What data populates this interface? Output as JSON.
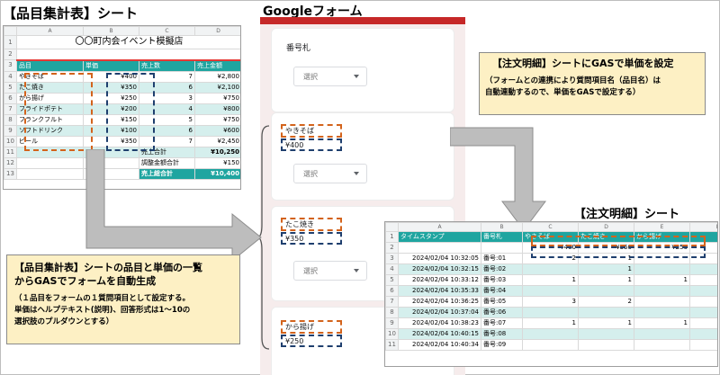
{
  "title_item_sheet": "【品目集計表】シート",
  "title_form": "Googleフォーム",
  "title_order_sheet": "【注文明細】シート",
  "sheet1": {
    "col_letters": [
      "A",
      "B",
      "C",
      "D"
    ],
    "row_numbers": [
      "1",
      "2",
      "3",
      "4",
      "5",
      "6",
      "7",
      "8",
      "9",
      "10",
      "11",
      "12",
      "13"
    ],
    "event_title": "〇〇町内会イベント模擬店",
    "headers": [
      "品目",
      "単価",
      "売上数",
      "売上金額"
    ],
    "items": [
      {
        "name": "やきそば",
        "price": "¥400",
        "qty": "7",
        "amount": "¥2,800"
      },
      {
        "name": "たこ焼き",
        "price": "¥350",
        "qty": "6",
        "amount": "¥2,100"
      },
      {
        "name": "から揚げ",
        "price": "¥250",
        "qty": "3",
        "amount": "¥750"
      },
      {
        "name": "フライドポテト",
        "price": "¥200",
        "qty": "4",
        "amount": "¥800"
      },
      {
        "name": "フランクフルト",
        "price": "¥150",
        "qty": "5",
        "amount": "¥750"
      },
      {
        "name": "ソフトドリンク",
        "price": "¥100",
        "qty": "6",
        "amount": "¥600"
      },
      {
        "name": "ビール",
        "price": "¥350",
        "qty": "7",
        "amount": "¥2,450"
      }
    ],
    "total_label": "売上合計",
    "total_value": "¥10,250",
    "adj_label": "調整金額合計",
    "adj_value": "¥150",
    "total2_label": "売上総合計",
    "total2_value": "¥10,400"
  },
  "form": {
    "q1_label": "番号札",
    "select_placeholder": "選択",
    "q2_label": "やきそば",
    "q2_price": "¥400",
    "q3_label": "たこ焼き",
    "q3_price": "¥350",
    "q4_label": "から揚げ",
    "q4_price": "¥250"
  },
  "note_top": {
    "line1": "【注文明細】シートにGASで単価を設定",
    "line2": "（フォームとの連携により質問項目名（品目名）は",
    "line3": "自動連動するので、単価をGASで設定する）"
  },
  "note_bottom": {
    "line1": "【品目集計表】シートの品目と単価の一覧",
    "line2": "からGASでフォームを自動生成",
    "line3": "（１品目をフォームの１質問項目として設定する。",
    "line4": "単価はヘルプテキスト(説明)、回答形式は1～10の",
    "line5": "選択肢のプルダウンとする）"
  },
  "sheet2": {
    "col_letters": [
      "A",
      "B",
      "C",
      "D",
      "E",
      "F"
    ],
    "headers": [
      "タイムスタンプ",
      "番号札",
      "やきそば",
      "たこ焼き",
      "から揚げ"
    ],
    "price_row": [
      "",
      "",
      "¥400",
      "¥350",
      "¥250"
    ],
    "rows": [
      {
        "rn": "3",
        "ts": "2024/02/04 10:32:05",
        "no": "番号:01",
        "a": "2",
        "b": "1",
        "c": ""
      },
      {
        "rn": "4",
        "ts": "2024/02/04 10:32:15",
        "no": "番号:02",
        "a": "",
        "b": "1",
        "c": ""
      },
      {
        "rn": "5",
        "ts": "2024/02/04 10:33:12",
        "no": "番号:03",
        "a": "1",
        "b": "1",
        "c": "1"
      },
      {
        "rn": "6",
        "ts": "2024/02/04 10:35:33",
        "no": "番号:04",
        "a": "",
        "b": "",
        "c": ""
      },
      {
        "rn": "7",
        "ts": "2024/02/04 10:36:25",
        "no": "番号:05",
        "a": "3",
        "b": "2",
        "c": ""
      },
      {
        "rn": "8",
        "ts": "2024/02/04 10:37:04",
        "no": "番号:06",
        "a": "",
        "b": "",
        "c": ""
      },
      {
        "rn": "9",
        "ts": "2024/02/04 10:38:23",
        "no": "番号:07",
        "a": "1",
        "b": "1",
        "c": "1"
      },
      {
        "rn": "10",
        "ts": "2024/02/04 10:40:15",
        "no": "番号:08",
        "a": "",
        "b": "",
        "c": ""
      },
      {
        "rn": "11",
        "ts": "2024/02/04 10:40:34",
        "no": "番号:09",
        "a": "",
        "b": "",
        "c": ""
      }
    ]
  }
}
